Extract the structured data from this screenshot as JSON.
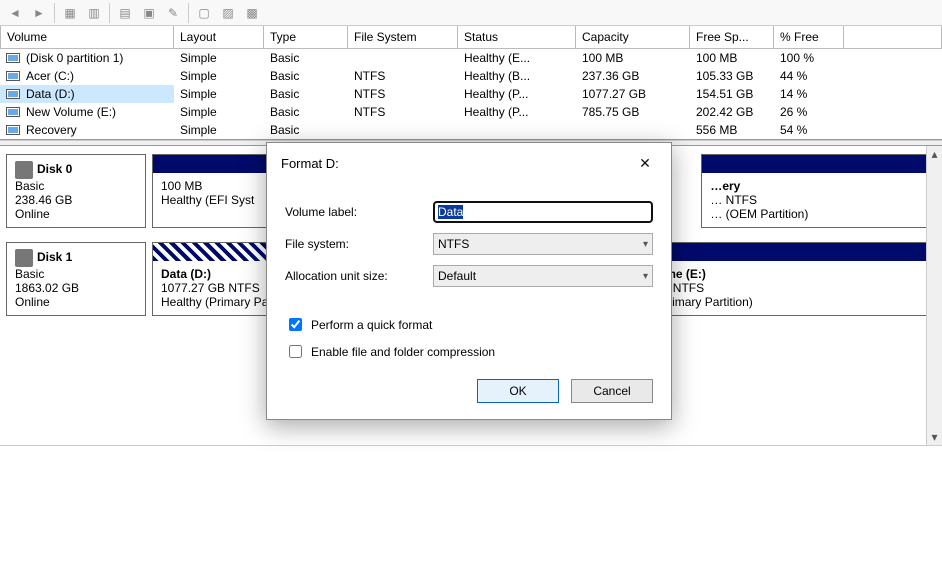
{
  "columns": [
    "Volume",
    "Layout",
    "Type",
    "File System",
    "Status",
    "Capacity",
    "Free Sp...",
    "% Free"
  ],
  "volumes": [
    {
      "name": "(Disk 0 partition 1)",
      "layout": "Simple",
      "type": "Basic",
      "fs": "",
      "status": "Healthy (E...",
      "capacity": "100 MB",
      "free": "100 MB",
      "pct": "100 %",
      "sel": false
    },
    {
      "name": "Acer (C:)",
      "layout": "Simple",
      "type": "Basic",
      "fs": "NTFS",
      "status": "Healthy (B...",
      "capacity": "237.36 GB",
      "free": "105.33 GB",
      "pct": "44 %",
      "sel": false
    },
    {
      "name": "Data (D:)",
      "layout": "Simple",
      "type": "Basic",
      "fs": "NTFS",
      "status": "Healthy (P...",
      "capacity": "1077.27 GB",
      "free": "154.51 GB",
      "pct": "14 %",
      "sel": true
    },
    {
      "name": "New Volume (E:)",
      "layout": "Simple",
      "type": "Basic",
      "fs": "NTFS",
      "status": "Healthy (P...",
      "capacity": "785.75 GB",
      "free": "202.42 GB",
      "pct": "26 %",
      "sel": false
    },
    {
      "name": "Recovery",
      "layout": "Simple",
      "type": "Basic",
      "fs": "",
      "status": "",
      "capacity": "",
      "free": "556 MB",
      "pct": "54 %",
      "sel": false
    }
  ],
  "disks": [
    {
      "label": "Disk 0",
      "type": "Basic",
      "size": "238.46 GB",
      "state": "Online",
      "parts": [
        {
          "title": "",
          "line1": "100 MB",
          "line2": "Healthy (EFI Syst",
          "flex": 1.0,
          "hatched": false
        },
        {
          "title": "",
          "line1": "",
          "line2": "",
          "flex": 3.0,
          "hatched": false,
          "hidden": true
        },
        {
          "title": "ery",
          "line1": "NTFS",
          "line2": "(OEM Partition)",
          "flex": 1.7,
          "hatched": false,
          "suffix": true
        }
      ]
    },
    {
      "label": "Disk 1",
      "type": "Basic",
      "size": "1863.02 GB",
      "state": "Online",
      "parts": [
        {
          "title": "Data  (D:)",
          "line1": "1077.27 GB NTFS",
          "line2": "Healthy (Primary Partition)",
          "flex": 3.0,
          "hatched": true
        },
        {
          "title": "New Volume  (E:)",
          "line1": "785.75 GB NTFS",
          "line2": "Healthy (Primary Partition)",
          "flex": 2.2,
          "hatched": false
        }
      ]
    }
  ],
  "dialog": {
    "title": "Format D:",
    "labels": {
      "vol": "Volume label:",
      "fs": "File system:",
      "aus": "Allocation unit size:"
    },
    "value": "Data",
    "fs": "NTFS",
    "aus": "Default",
    "quick": "Perform a quick format",
    "compress": "Enable file and folder compression",
    "quick_checked": true,
    "compress_checked": false,
    "ok": "OK",
    "cancel": "Cancel"
  }
}
